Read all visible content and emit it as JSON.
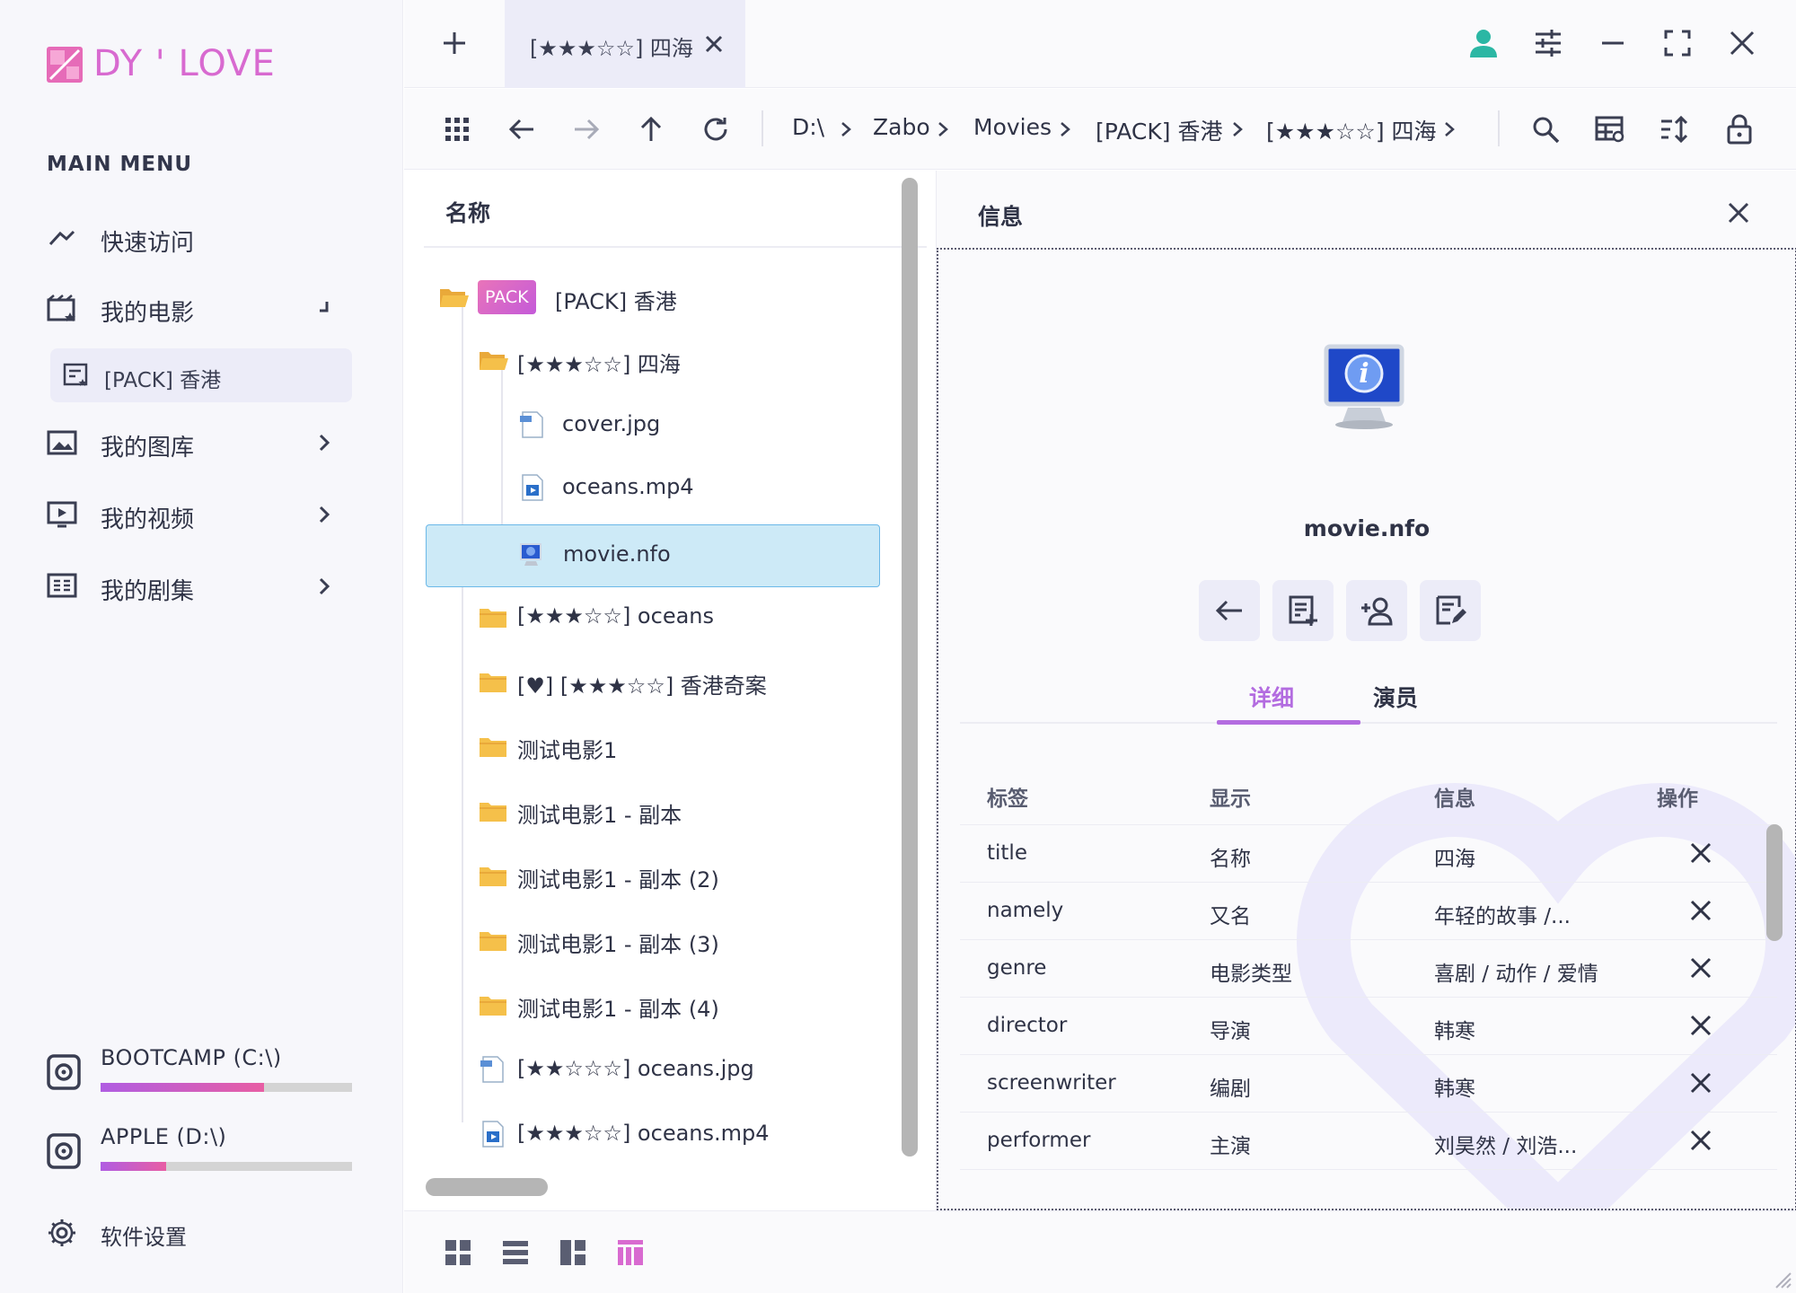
{
  "app": {
    "logo_text": "DY ' LOVE",
    "brand_color": "#d86ad0"
  },
  "sidebar": {
    "menu_title": "MAIN MENU",
    "items": [
      {
        "label": "快速访问",
        "icon": "quick-access-icon",
        "expanded": true
      },
      {
        "label": "我的电影",
        "icon": "movies-icon",
        "expanded": true
      },
      {
        "label": "我的图库",
        "icon": "gallery-icon",
        "expanded": false
      },
      {
        "label": "我的视频",
        "icon": "video-icon",
        "expanded": false
      },
      {
        "label": "我的剧集",
        "icon": "series-icon",
        "expanded": false
      }
    ],
    "sub_item": {
      "label": "[PACK] 香港",
      "icon": "pack-icon"
    },
    "drives": [
      {
        "label": "BOOTCAMP  (C:\\)",
        "usage": 0.65
      },
      {
        "label": "APPLE  (D:\\)",
        "usage": 0.26
      }
    ],
    "settings_label": "软件设置"
  },
  "tabs": {
    "active_label": "[★★★☆☆] 四海"
  },
  "toolbar": {
    "breadcrumb": [
      "D:\\",
      "Zabo",
      "Movies",
      "[PACK] 香港",
      "[★★★☆☆] 四海"
    ]
  },
  "tree": {
    "header": "名称",
    "badge": "PACK",
    "rows": [
      {
        "label": "[PACK] 香港",
        "type": "folder-open",
        "level": 0
      },
      {
        "label": "[★★★☆☆] 四海",
        "type": "folder-open",
        "level": 1
      },
      {
        "label": "cover.jpg",
        "type": "jpg",
        "level": 2
      },
      {
        "label": "oceans.mp4",
        "type": "video",
        "level": 2
      },
      {
        "label": "movie.nfo",
        "type": "nfo",
        "level": 2,
        "selected": true
      },
      {
        "label": "[★★★☆☆] oceans",
        "type": "folder",
        "level": 1
      },
      {
        "label": "[♥] [★★★☆☆] 香港奇案",
        "type": "folder",
        "level": 1
      },
      {
        "label": "测试电影1",
        "type": "folder",
        "level": 1
      },
      {
        "label": "测试电影1 - 副本",
        "type": "folder",
        "level": 1
      },
      {
        "label": "测试电影1 - 副本 (2)",
        "type": "folder",
        "level": 1
      },
      {
        "label": "测试电影1 - 副本 (3)",
        "type": "folder",
        "level": 1
      },
      {
        "label": "测试电影1 - 副本 (4)",
        "type": "folder",
        "level": 1
      },
      {
        "label": "[★★☆☆☆] oceans.jpg",
        "type": "jpg",
        "level": 1
      },
      {
        "label": "[★★★☆☆] oceans.mp4",
        "type": "video",
        "level": 1
      }
    ]
  },
  "info": {
    "title": "信息",
    "file_name": "movie.nfo",
    "tabs": [
      {
        "label": "详细",
        "active": true
      },
      {
        "label": "演员",
        "active": false
      }
    ],
    "columns": [
      "标签",
      "显示",
      "信息",
      "操作"
    ],
    "rows": [
      {
        "tag": "title",
        "display": "名称",
        "info": "四海"
      },
      {
        "tag": "namely",
        "display": "又名",
        "info": "年轻的故事 /..."
      },
      {
        "tag": "genre",
        "display": "电影类型",
        "info": "喜剧 / 动作 / 爱情"
      },
      {
        "tag": "director",
        "display": "导演",
        "info": "韩寒"
      },
      {
        "tag": "screenwriter",
        "display": "编剧",
        "info": "韩寒"
      },
      {
        "tag": "performer",
        "display": "主演",
        "info": "刘昊然 / 刘浩..."
      }
    ]
  },
  "colors": {
    "accent": "#b36ce0",
    "selected_row": "#cdeaf7",
    "folder": "#f5c04a"
  }
}
